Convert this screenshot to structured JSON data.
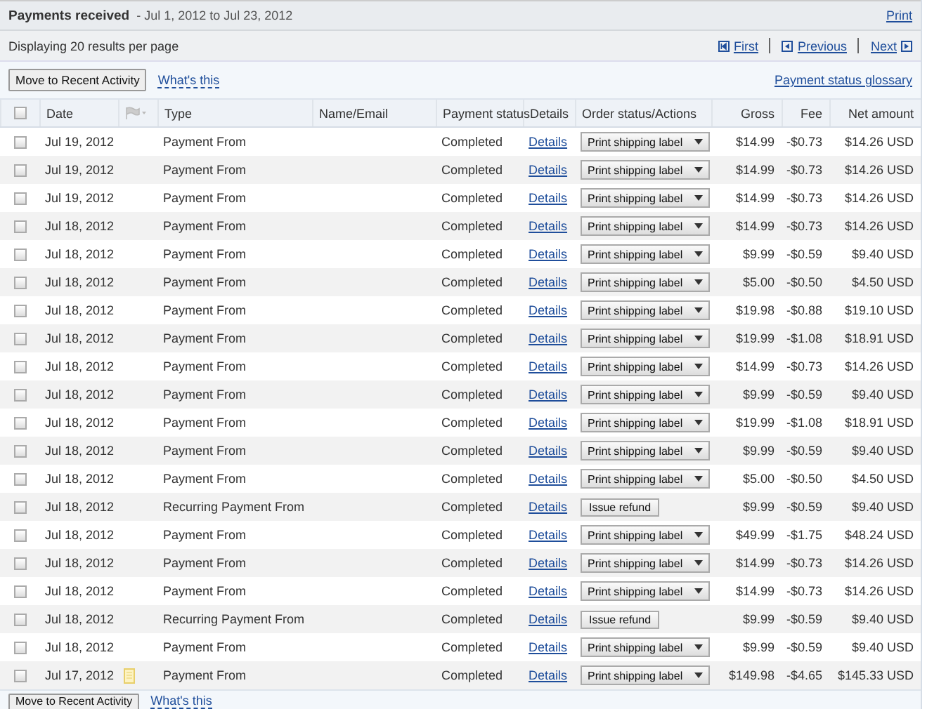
{
  "header": {
    "title": "Payments received",
    "range": "- Jul 1, 2012 to Jul 23, 2012",
    "print_link": "Print"
  },
  "paging": {
    "info": "Displaying 20 results per page",
    "first": "First",
    "previous": "Previous",
    "next": "Next"
  },
  "toolbar": {
    "button": "Move to Recent Activity",
    "help_link": "What's this",
    "glossary_link": "Payment status glossary"
  },
  "table": {
    "select_all_checked": false,
    "columns": [
      "Date",
      "Type",
      "Name/Email",
      "Payment status",
      "Details",
      "Order status/Actions",
      "Gross",
      "Fee",
      "Net amount"
    ],
    "rows": [
      {
        "checked": false,
        "date": "Jul 19, 2012",
        "note": false,
        "type": "Payment From",
        "status": "Completed",
        "details": "Details",
        "action": {
          "kind": "dropdown",
          "label": "Print shipping label"
        },
        "gross": "$14.99",
        "fee": "-$0.73",
        "net": "$14.26 USD"
      },
      {
        "checked": false,
        "date": "Jul 19, 2012",
        "note": false,
        "type": "Payment From",
        "status": "Completed",
        "details": "Details",
        "action": {
          "kind": "dropdown",
          "label": "Print shipping label"
        },
        "gross": "$14.99",
        "fee": "-$0.73",
        "net": "$14.26 USD"
      },
      {
        "checked": false,
        "date": "Jul 19, 2012",
        "note": false,
        "type": "Payment From",
        "status": "Completed",
        "details": "Details",
        "action": {
          "kind": "dropdown",
          "label": "Print shipping label"
        },
        "gross": "$14.99",
        "fee": "-$0.73",
        "net": "$14.26 USD"
      },
      {
        "checked": false,
        "date": "Jul 18, 2012",
        "note": false,
        "type": "Payment From",
        "status": "Completed",
        "details": "Details",
        "action": {
          "kind": "dropdown",
          "label": "Print shipping label"
        },
        "gross": "$14.99",
        "fee": "-$0.73",
        "net": "$14.26 USD"
      },
      {
        "checked": false,
        "date": "Jul 18, 2012",
        "note": false,
        "type": "Payment From",
        "status": "Completed",
        "details": "Details",
        "action": {
          "kind": "dropdown",
          "label": "Print shipping label"
        },
        "gross": "$9.99",
        "fee": "-$0.59",
        "net": "$9.40 USD"
      },
      {
        "checked": false,
        "date": "Jul 18, 2012",
        "note": false,
        "type": "Payment From",
        "status": "Completed",
        "details": "Details",
        "action": {
          "kind": "dropdown",
          "label": "Print shipping label"
        },
        "gross": "$5.00",
        "fee": "-$0.50",
        "net": "$4.50 USD"
      },
      {
        "checked": false,
        "date": "Jul 18, 2012",
        "note": false,
        "type": "Payment From",
        "status": "Completed",
        "details": "Details",
        "action": {
          "kind": "dropdown",
          "label": "Print shipping label"
        },
        "gross": "$19.98",
        "fee": "-$0.88",
        "net": "$19.10 USD"
      },
      {
        "checked": false,
        "date": "Jul 18, 2012",
        "note": false,
        "type": "Payment From",
        "status": "Completed",
        "details": "Details",
        "action": {
          "kind": "dropdown",
          "label": "Print shipping label"
        },
        "gross": "$19.99",
        "fee": "-$1.08",
        "net": "$18.91 USD"
      },
      {
        "checked": false,
        "date": "Jul 18, 2012",
        "note": false,
        "type": "Payment From",
        "status": "Completed",
        "details": "Details",
        "action": {
          "kind": "dropdown",
          "label": "Print shipping label"
        },
        "gross": "$14.99",
        "fee": "-$0.73",
        "net": "$14.26 USD"
      },
      {
        "checked": false,
        "date": "Jul 18, 2012",
        "note": false,
        "type": "Payment From",
        "status": "Completed",
        "details": "Details",
        "action": {
          "kind": "dropdown",
          "label": "Print shipping label"
        },
        "gross": "$9.99",
        "fee": "-$0.59",
        "net": "$9.40 USD"
      },
      {
        "checked": false,
        "date": "Jul 18, 2012",
        "note": false,
        "type": "Payment From",
        "status": "Completed",
        "details": "Details",
        "action": {
          "kind": "dropdown",
          "label": "Print shipping label"
        },
        "gross": "$19.99",
        "fee": "-$1.08",
        "net": "$18.91 USD"
      },
      {
        "checked": false,
        "date": "Jul 18, 2012",
        "note": false,
        "type": "Payment From",
        "status": "Completed",
        "details": "Details",
        "action": {
          "kind": "dropdown",
          "label": "Print shipping label"
        },
        "gross": "$9.99",
        "fee": "-$0.59",
        "net": "$9.40 USD"
      },
      {
        "checked": false,
        "date": "Jul 18, 2012",
        "note": false,
        "type": "Payment From",
        "status": "Completed",
        "details": "Details",
        "action": {
          "kind": "dropdown",
          "label": "Print shipping label"
        },
        "gross": "$5.00",
        "fee": "-$0.50",
        "net": "$4.50 USD"
      },
      {
        "checked": false,
        "date": "Jul 18, 2012",
        "note": false,
        "type": "Recurring Payment From",
        "status": "Completed",
        "details": "Details",
        "action": {
          "kind": "button",
          "label": "Issue refund"
        },
        "gross": "$9.99",
        "fee": "-$0.59",
        "net": "$9.40 USD"
      },
      {
        "checked": false,
        "date": "Jul 18, 2012",
        "note": false,
        "type": "Payment From",
        "status": "Completed",
        "details": "Details",
        "action": {
          "kind": "dropdown",
          "label": "Print shipping label"
        },
        "gross": "$49.99",
        "fee": "-$1.75",
        "net": "$48.24 USD"
      },
      {
        "checked": false,
        "date": "Jul 18, 2012",
        "note": false,
        "type": "Payment From",
        "status": "Completed",
        "details": "Details",
        "action": {
          "kind": "dropdown",
          "label": "Print shipping label"
        },
        "gross": "$14.99",
        "fee": "-$0.73",
        "net": "$14.26 USD"
      },
      {
        "checked": false,
        "date": "Jul 18, 2012",
        "note": false,
        "type": "Payment From",
        "status": "Completed",
        "details": "Details",
        "action": {
          "kind": "dropdown",
          "label": "Print shipping label"
        },
        "gross": "$14.99",
        "fee": "-$0.73",
        "net": "$14.26 USD"
      },
      {
        "checked": false,
        "date": "Jul 18, 2012",
        "note": false,
        "type": "Recurring Payment From",
        "status": "Completed",
        "details": "Details",
        "action": {
          "kind": "button",
          "label": "Issue refund"
        },
        "gross": "$9.99",
        "fee": "-$0.59",
        "net": "$9.40 USD"
      },
      {
        "checked": false,
        "date": "Jul 18, 2012",
        "note": false,
        "type": "Payment From",
        "status": "Completed",
        "details": "Details",
        "action": {
          "kind": "dropdown",
          "label": "Print shipping label"
        },
        "gross": "$9.99",
        "fee": "-$0.59",
        "net": "$9.40 USD"
      },
      {
        "checked": false,
        "date": "Jul 17, 2012",
        "note": true,
        "type": "Payment From",
        "status": "Completed",
        "details": "Details",
        "action": {
          "kind": "dropdown",
          "label": "Print shipping label"
        },
        "gross": "$149.98",
        "fee": "-$4.65",
        "net": "$145.33 USD"
      }
    ]
  },
  "bottom_toolbar": {
    "button": "Move to Recent Activity",
    "help_link": "What's this"
  }
}
